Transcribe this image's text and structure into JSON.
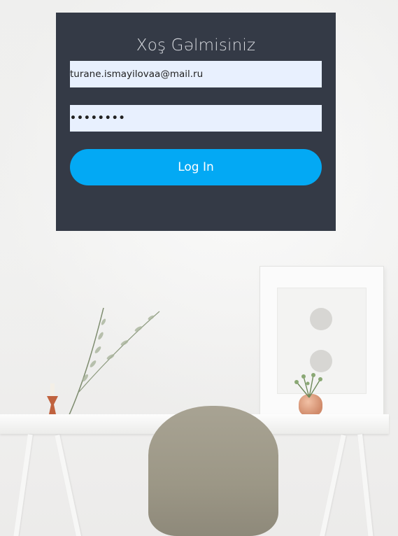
{
  "login": {
    "title": "Xoş Gəlmisiniz",
    "email_value": "turane.ismayilovaa@mail.ru",
    "password_value": "••••••••",
    "submit_label": "Log In"
  },
  "colors": {
    "card_bg": "#343a46",
    "button_bg": "#03a9f4",
    "input_bg": "#e8f0fe",
    "title_color": "#d8dbe0"
  }
}
